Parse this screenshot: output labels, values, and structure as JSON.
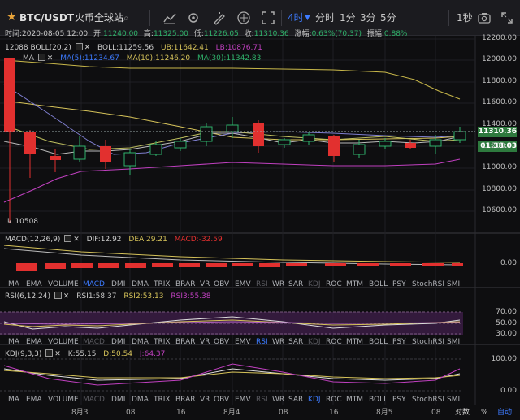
{
  "toolbar": {
    "symbol": "BTC/USDT",
    "exchange": "火币全球站",
    "interval": "4时",
    "periods": [
      "分时",
      "1分",
      "3分",
      "5分"
    ],
    "right_label": "1秒",
    "icons": [
      "star-icon",
      "indicator-icon",
      "settings-icon",
      "draw-icon",
      "compare-icon",
      "fullscreen-icon",
      "camera-icon",
      "expand-icon"
    ]
  },
  "info": {
    "time_label": "时间:",
    "time": "2020-08-05 12:00",
    "open_label": "开:",
    "open": "11240.00",
    "high_label": "高:",
    "high": "11325.00",
    "low_label": "低:",
    "low": "11226.05",
    "close_label": "收:",
    "close": "11310.36",
    "change_label": "涨幅:",
    "change": "0.63%(70.37)",
    "amplitude_label": "振幅:",
    "amplitude": "0.88%"
  },
  "boll": {
    "name": "BOLL(20,2)",
    "boll": "BOLL:11259.56",
    "ub": "UB:11642.41",
    "lb": "LB:10876.71",
    "high_marker": "12088"
  },
  "ma": {
    "name": "MA",
    "ma5": "MA(5):11234.67",
    "ma10": "MA(10):11246.20",
    "ma30": "MA(30):11342.83",
    "low_marker": "10508"
  },
  "price_axis": [
    "12200.00",
    "12000.00",
    "11800.00",
    "11600.00",
    "11400.00",
    "11200.00",
    "11000.00",
    "10800.00",
    "10600.00"
  ],
  "price_tag": "11310.36",
  "countdown_tag": "01:38:03",
  "macd": {
    "name": "MACD(12,26,9)",
    "dif": "DIF:12.92",
    "dea": "DEA:29.21",
    "macd": "MACD:-32.59",
    "axis": "0.00"
  },
  "rsi": {
    "name": "RSI(6,12,24)",
    "rsi1": "RSI1:58.37",
    "rsi2": "RSI2:53.13",
    "rsi3": "RSI3:55.38",
    "axis": [
      "70.00",
      "50.00",
      "30.00"
    ]
  },
  "kdj": {
    "name": "KDJ(9,3,3)",
    "k": "K:55.15",
    "d": "D:50.54",
    "j": "J:64.37",
    "axis": [
      "100.00",
      "0.00"
    ]
  },
  "indicator_tabs": [
    "MA",
    "EMA",
    "VOLUME",
    "MACD",
    "DMI",
    "DMA",
    "TRIX",
    "BRAR",
    "VR",
    "OBV",
    "EMV",
    "RSI",
    "WR",
    "SAR",
    "KDJ",
    "ROC",
    "MTM",
    "BOLL",
    "PSY",
    "StochRSI",
    "SMI"
  ],
  "time_axis": [
    "8月3",
    "08",
    "16",
    "8月4",
    "08",
    "16",
    "8月5",
    "08"
  ],
  "bottom_right": {
    "log": "对数",
    "percent": "%",
    "auto": "自动"
  },
  "colors": {
    "up": "#2fb36b",
    "down": "#e2302f",
    "ma5": "#ffffff",
    "ma10": "#d6c35a",
    "ma30": "#8e5fd6",
    "ub": "#c9b84a",
    "lb": "#c040c0",
    "accent": "#3d7bff",
    "price_tag": "#3a9a4a"
  }
}
